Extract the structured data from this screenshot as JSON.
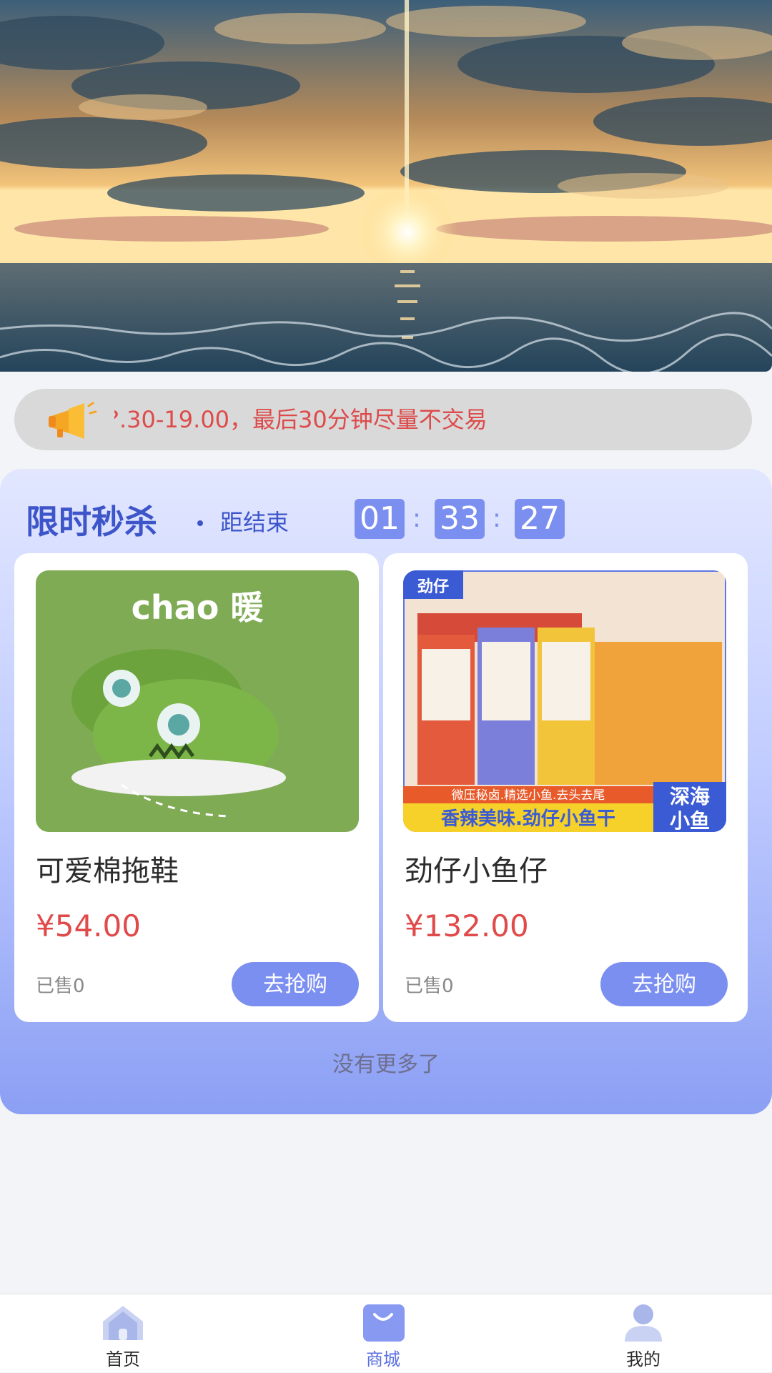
{
  "notice": {
    "text": "?.30-19.00，最后30分钟尽量不交易",
    "icon": "megaphone-icon"
  },
  "flash_sale": {
    "title": "限时秒杀",
    "countdown_label": "距结束",
    "timer": {
      "hours": "01",
      "minutes": "33",
      "seconds": "27",
      "separator": ":"
    },
    "products": [
      {
        "name": "可爱棉拖鞋",
        "price": "¥54.00",
        "sold": "已售0",
        "button": "去抢购",
        "image_text": "chao 暖"
      },
      {
        "name": "劲仔小鱼仔",
        "price": "¥132.00",
        "sold": "已售0",
        "button": "去抢购",
        "image_brand": "劲仔",
        "image_banner": "香辣美味.劲仔小鱼干",
        "image_subbanner": "微压秘卤.精选小鱼.去头去尾",
        "image_badge_line1": "深海",
        "image_badge_line2": "小鱼"
      }
    ],
    "footer": "没有更多了"
  },
  "tabbar": {
    "items": [
      {
        "label": "首页",
        "icon": "home-icon",
        "active": false
      },
      {
        "label": "商城",
        "icon": "shopping-bag-icon",
        "active": true
      },
      {
        "label": "我的",
        "icon": "user-icon",
        "active": false
      }
    ]
  },
  "colors": {
    "accent": "#7b8ff0",
    "title": "#3d55c9",
    "price": "#e04a4a",
    "notice_text": "#dd4b4b"
  }
}
